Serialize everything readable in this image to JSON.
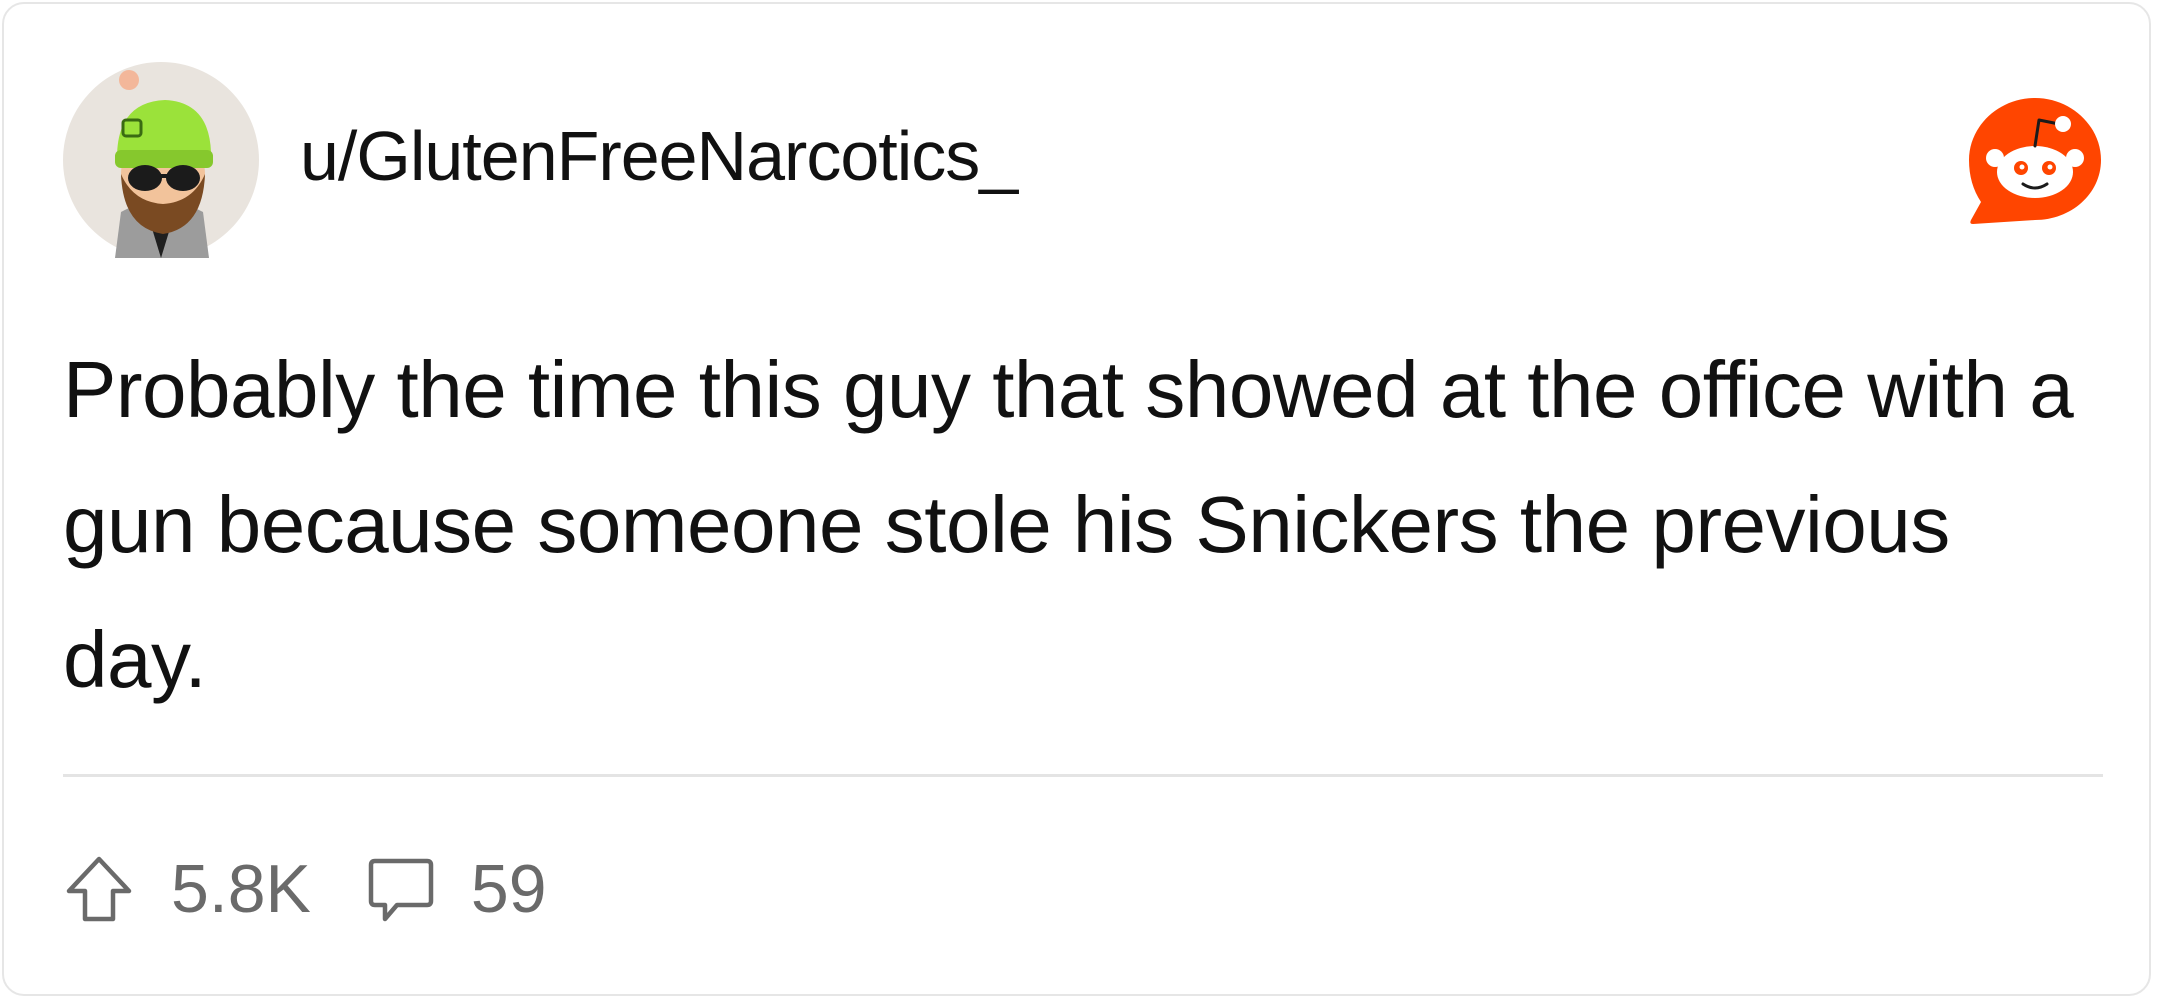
{
  "post": {
    "username": "u/GlutenFreeNarcotics_",
    "body": "Probably the time this guy that showed at the office with a gun because someone stole his Snickers the previous day.",
    "upvotes": "5.8K",
    "comments": "59"
  },
  "icons": {
    "avatar": "user-avatar-icon",
    "brand": "reddit-logo-icon",
    "upvote": "upvote-arrow-icon",
    "comment": "comment-bubble-icon"
  },
  "colors": {
    "reddit_orange": "#FF4500",
    "text_primary": "#111111",
    "text_secondary": "#6A6A6A",
    "divider": "#E4E4E4",
    "avatar_bg": "#E9E4DE",
    "beanie": "#9BE23A"
  }
}
